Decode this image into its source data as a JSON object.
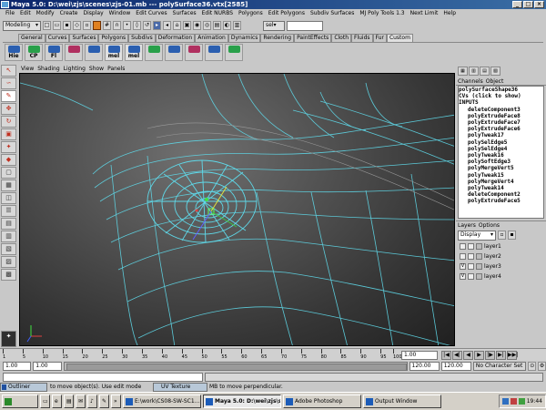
{
  "title": "Maya 5.0: D:\\wei\\zjs\\scenes\\zjs-01.mb  ---  polySurface36.vtx[2585]",
  "window_buttons": [
    "_",
    "□",
    "×"
  ],
  "menu": [
    "File",
    "Edit",
    "Modify",
    "Create",
    "Display",
    "Window",
    "Edit Curves",
    "Surfaces",
    "Edit NURBS",
    "Polygons",
    "Edit Polygons",
    "Subdiv Surfaces",
    "MJ Poly Tools 1.3",
    "Next Limit",
    "Help"
  ],
  "status_line": {
    "mode": "Modeling",
    "sel_label": "sel▾"
  },
  "shelf_tabs": [
    "General",
    "Curves",
    "Surfaces",
    "Polygons",
    "Subdivs",
    "Deformation",
    "Animation",
    "Dynamics",
    "Rendering",
    "PaintEffects",
    "Cloth",
    "Fluids",
    "Fur",
    "Custom"
  ],
  "active_shelf": "Custom",
  "shelf_buttons": [
    "Hie",
    "CP",
    "Fl",
    "",
    "",
    "mel",
    "mel",
    "",
    "",
    "",
    "",
    ""
  ],
  "viewport_menu": [
    "View",
    "Shading",
    "Lighting",
    "Show",
    "Panels"
  ],
  "channels": {
    "header": [
      "Channels",
      "Object"
    ],
    "object": "polySurfaceShape36",
    "cvs": "CVs (click to show)",
    "inputs_label": "INPUTS",
    "inputs": [
      "deleteComponent3",
      "polyExtrudeFace8",
      "polyExtrudeFace7",
      "polyExtrudeFace6",
      "polyTweak17",
      "polySelEdge5",
      "polySelEdge4",
      "polyTweak16",
      "polySoftEdge3",
      "polyMergeVert5",
      "polyTweak15",
      "polyMergeVert4",
      "polyTweak14",
      "deleteComponent2",
      "polyExtrudeFace5"
    ]
  },
  "layers": {
    "menu": [
      "Layers",
      "Options"
    ],
    "display": "Display",
    "items": [
      {
        "name": "layer1",
        "visible": ""
      },
      {
        "name": "layer2",
        "visible": ""
      },
      {
        "name": "layer3",
        "visible": "V"
      },
      {
        "name": "layer4",
        "visible": "V"
      }
    ]
  },
  "timeline": {
    "ticks": [
      "1",
      "5",
      "10",
      "15",
      "20",
      "25",
      "30",
      "35",
      "40",
      "45",
      "50",
      "55",
      "60",
      "65",
      "70",
      "75",
      "80",
      "85",
      "90",
      "95",
      "100"
    ],
    "current": "1.00",
    "playback": [
      "|◀",
      "◀|",
      "◀",
      "▶",
      "|▶",
      "▶|",
      "▶▶|"
    ]
  },
  "range": {
    "start": "1.00",
    "start2": "1.00",
    "end1": "120.00",
    "end2": "120.00",
    "character": "No Character Set"
  },
  "help": {
    "outliner": "Outliner",
    "text1": "to move object(s). Use edit mode",
    "uv_texture": "UV Texture",
    "text2": "MB to move perpendicular."
  },
  "taskbar": {
    "items": [
      "E:\\work\\CS08-SW-SC1...",
      "Maya 5.0: D:\\wei\\zjs\\s...",
      "Adobe Photoshop",
      "Output Window"
    ],
    "active": 1,
    "time": "19:44"
  },
  "colors": {
    "wire": "#5fd8e8",
    "title_bg": "#0a246a",
    "bg": "#c8c8c8"
  }
}
